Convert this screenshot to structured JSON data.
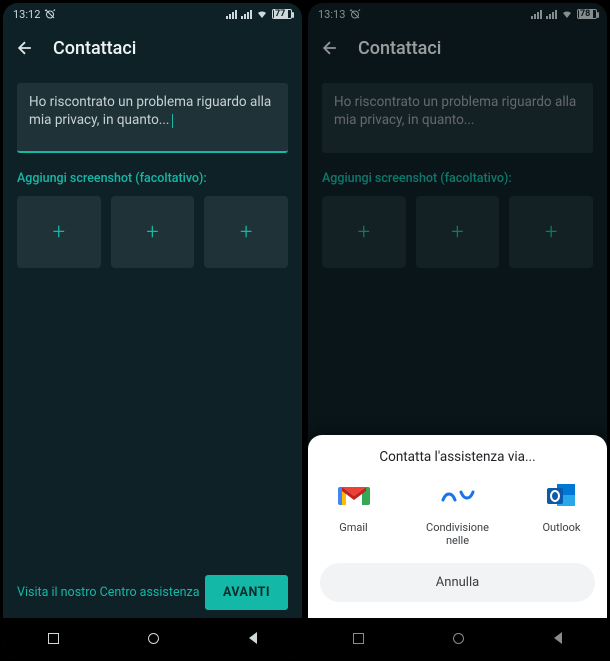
{
  "left": {
    "status": {
      "time": "13:12",
      "battery": "77"
    },
    "title": "Contattaci",
    "message": "Ho riscontrato un problema riguardo alla mia privacy, in quanto...",
    "addScreenshotLabel": "Aggiungi screenshot (facoltativo):",
    "helpLink": "Visita il nostro Centro assistenza",
    "nextBtn": "AVANTI"
  },
  "right": {
    "status": {
      "time": "13:13",
      "battery": "78"
    },
    "title": "Contattaci",
    "message": "Ho riscontrato un problema riguardo alla mia privacy, in quanto...",
    "addScreenshotLabel": "Aggiungi screenshot (facoltativo):",
    "sheet": {
      "title": "Contatta l'assistenza via...",
      "apps": [
        {
          "label": "Gmail"
        },
        {
          "label": "Condivisione nelle"
        },
        {
          "label": "Outlook"
        }
      ],
      "cancel": "Annulla"
    }
  }
}
